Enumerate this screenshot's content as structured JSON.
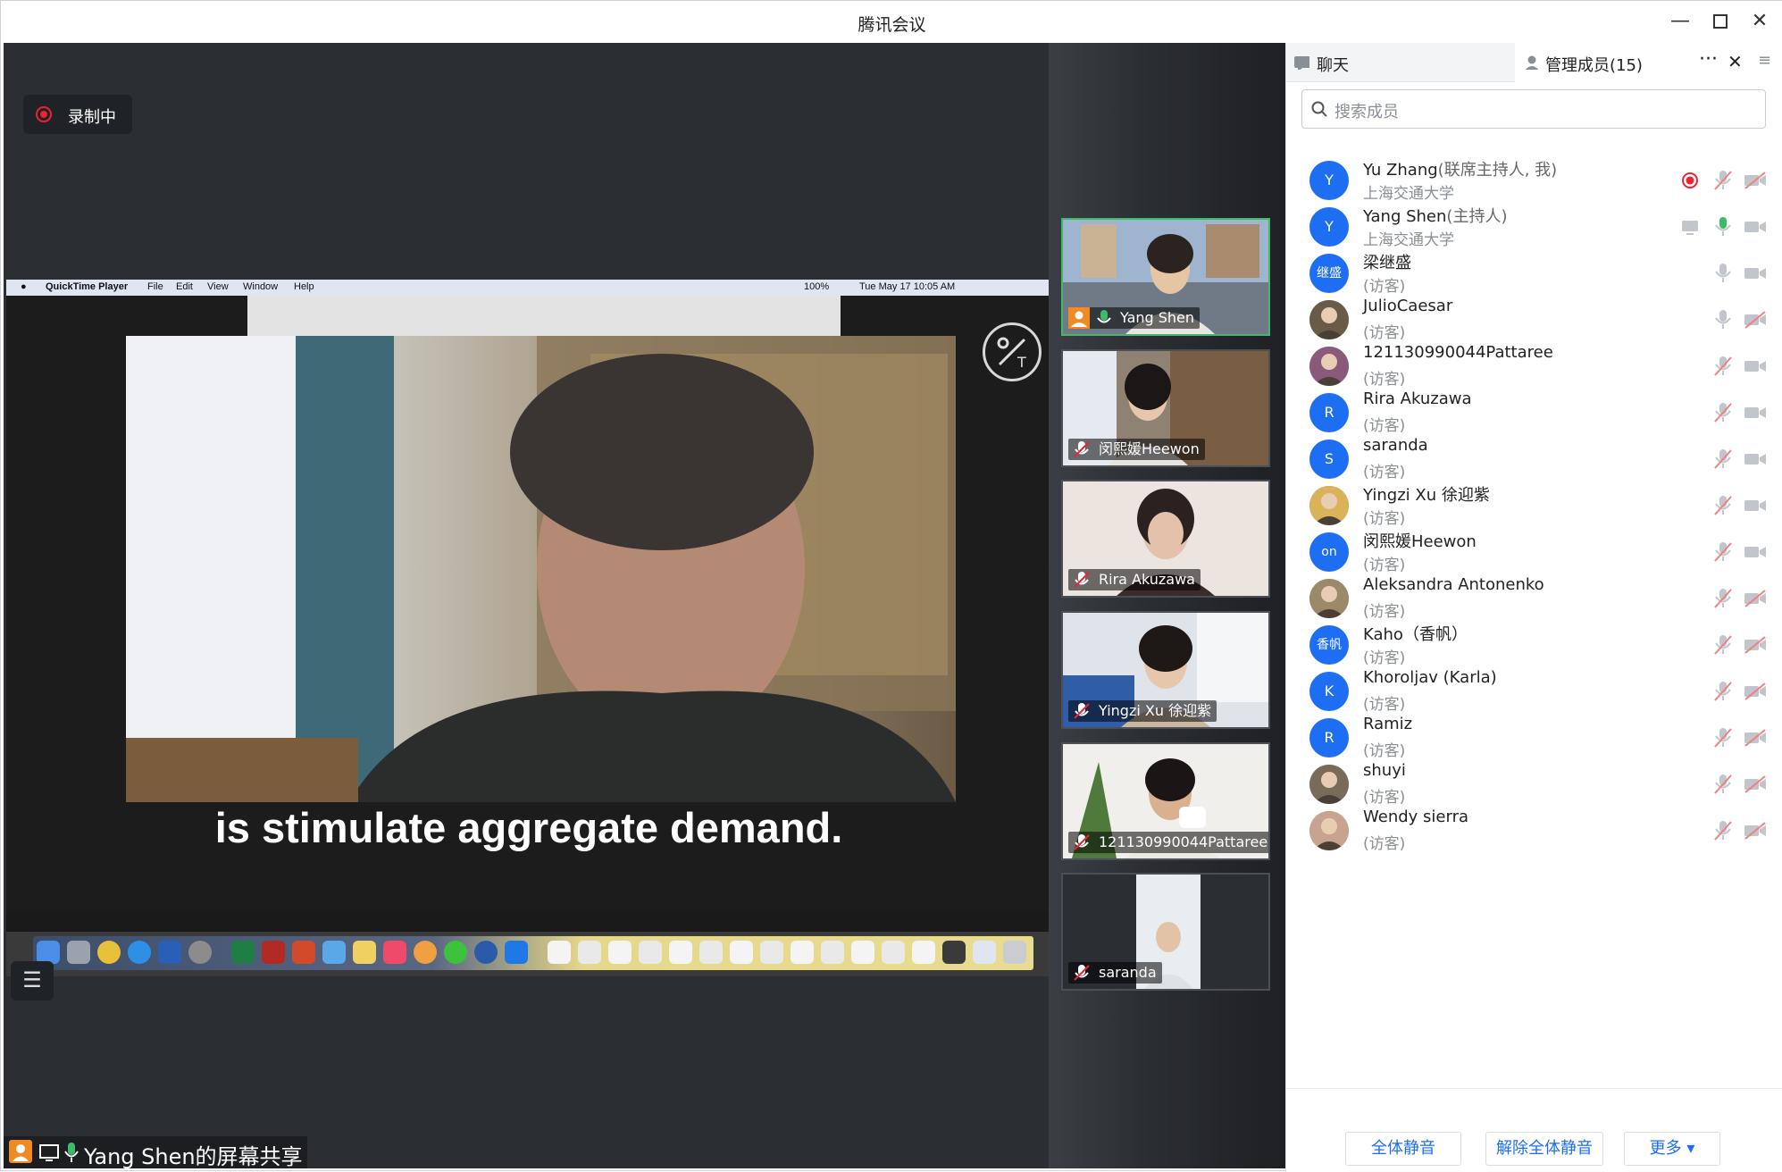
{
  "window": {
    "title": "腾讯会议"
  },
  "recording": {
    "label": "录制中"
  },
  "shared_screen": {
    "menubar": {
      "app": "QuickTime Player",
      "menus": [
        "File",
        "Edit",
        "View",
        "Window",
        "Help"
      ],
      "battery": "100%",
      "clock": "Tue May 17  10:05 AM"
    },
    "subtitle": "is stimulate aggregate demand."
  },
  "share_label": "Yang Shen的屏幕共享",
  "gallery": [
    {
      "name": "Yang Shen",
      "mic": "on",
      "active": true
    },
    {
      "name": "闵熙媛Heewon",
      "mic": "muted",
      "active": false
    },
    {
      "name": "Rira Akuzawa",
      "mic": "muted",
      "active": false
    },
    {
      "name": "Yingzi Xu 徐迎紫",
      "mic": "muted",
      "active": false
    },
    {
      "name": "121130990044Pattaree",
      "mic": "muted",
      "active": false
    },
    {
      "name": "saranda",
      "mic": "muted",
      "active": false
    }
  ],
  "panel": {
    "tab_chat": "聊天",
    "tab_members": "管理成员(15)",
    "search_placeholder": "搜索成员",
    "members": [
      {
        "name": "Yu Zhang",
        "role": "(联席主持人, 我)",
        "sub": "上海交通大学",
        "avatar": "Y",
        "photo": false,
        "mic": "muted",
        "cam": "off",
        "extra": "recording"
      },
      {
        "name": "Yang Shen",
        "role": "(主持人)",
        "sub": "上海交通大学",
        "avatar": "Y",
        "photo": false,
        "mic": "on",
        "cam": "on",
        "extra": "sharing"
      },
      {
        "name": "梁继盛",
        "role": "",
        "sub": "(访客)",
        "avatar": "继盛",
        "photo": false,
        "mic": "available",
        "cam": "on",
        "extra": ""
      },
      {
        "name": "JulioCaesar",
        "role": "",
        "sub": "(访客)",
        "avatar": "",
        "photo": true,
        "mic": "available",
        "cam": "off",
        "extra": ""
      },
      {
        "name": "121130990044Pattaree",
        "role": "",
        "sub": "(访客)",
        "avatar": "",
        "photo": true,
        "mic": "muted",
        "cam": "on",
        "extra": ""
      },
      {
        "name": "Rira Akuzawa",
        "role": "",
        "sub": "(访客)",
        "avatar": "R",
        "photo": false,
        "mic": "muted",
        "cam": "on",
        "extra": ""
      },
      {
        "name": "saranda",
        "role": "",
        "sub": "(访客)",
        "avatar": "S",
        "photo": false,
        "mic": "muted",
        "cam": "on",
        "extra": ""
      },
      {
        "name": "Yingzi Xu 徐迎紫",
        "role": "",
        "sub": "(访客)",
        "avatar": "",
        "photo": true,
        "mic": "muted",
        "cam": "on",
        "extra": ""
      },
      {
        "name": "闵熙媛Heewon",
        "role": "",
        "sub": "(访客)",
        "avatar": "on",
        "photo": false,
        "mic": "muted",
        "cam": "on",
        "extra": ""
      },
      {
        "name": "Aleksandra Antonenko",
        "role": "",
        "sub": "(访客)",
        "avatar": "",
        "photo": true,
        "mic": "muted",
        "cam": "off",
        "extra": ""
      },
      {
        "name": "Kaho（香帆）",
        "role": "",
        "sub": "(访客)",
        "avatar": "香帆",
        "photo": false,
        "mic": "muted",
        "cam": "off",
        "extra": ""
      },
      {
        "name": "Khoroljav (Karla)",
        "role": "",
        "sub": "(访客)",
        "avatar": "K",
        "photo": false,
        "mic": "muted",
        "cam": "off",
        "extra": ""
      },
      {
        "name": "Ramiz",
        "role": "",
        "sub": "(访客)",
        "avatar": "R",
        "photo": false,
        "mic": "muted",
        "cam": "off",
        "extra": ""
      },
      {
        "name": "shuyi",
        "role": "",
        "sub": "(访客)",
        "avatar": "",
        "photo": true,
        "mic": "muted",
        "cam": "off",
        "extra": ""
      },
      {
        "name": "Wendy sierra",
        "role": "",
        "sub": "(访客)",
        "avatar": "",
        "photo": true,
        "mic": "muted",
        "cam": "off",
        "extra": ""
      }
    ],
    "footer": {
      "mute_all": "全体静音",
      "unmute_all": "解除全体静音",
      "more": "更多 ▾"
    }
  },
  "colors": {
    "accent": "#1d6ef2",
    "stage_bg": "#2b2e33",
    "active_border": "#3dbb6a",
    "recording": "#e22233"
  }
}
